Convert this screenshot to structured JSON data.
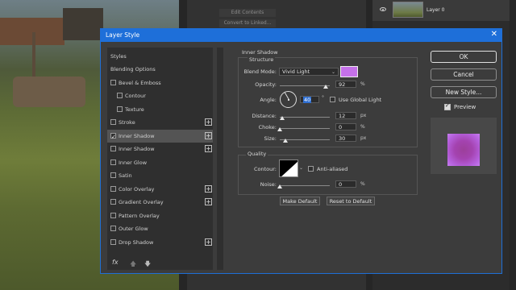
{
  "background": {
    "top_button_1": "Edit Contents",
    "top_button_2": "Convert to Linked...",
    "layer_name": "Layer 0"
  },
  "dialog": {
    "title": "Layer Style",
    "styles_header": "Styles",
    "items": [
      {
        "label": "Blending Options",
        "checkbox": false,
        "checked": false,
        "plus": false,
        "indent": false
      },
      {
        "label": "Bevel & Emboss",
        "checkbox": true,
        "checked": false,
        "plus": false,
        "indent": false
      },
      {
        "label": "Contour",
        "checkbox": true,
        "checked": false,
        "plus": false,
        "indent": true
      },
      {
        "label": "Texture",
        "checkbox": true,
        "checked": false,
        "plus": false,
        "indent": true
      },
      {
        "label": "Stroke",
        "checkbox": true,
        "checked": false,
        "plus": true,
        "indent": false
      },
      {
        "label": "Inner Shadow",
        "checkbox": true,
        "checked": true,
        "plus": true,
        "indent": false,
        "active": true
      },
      {
        "label": "Inner Shadow",
        "checkbox": true,
        "checked": false,
        "plus": true,
        "indent": false
      },
      {
        "label": "Inner Glow",
        "checkbox": true,
        "checked": false,
        "plus": false,
        "indent": false
      },
      {
        "label": "Satin",
        "checkbox": true,
        "checked": false,
        "plus": false,
        "indent": false
      },
      {
        "label": "Color Overlay",
        "checkbox": true,
        "checked": false,
        "plus": true,
        "indent": false
      },
      {
        "label": "Gradient Overlay",
        "checkbox": true,
        "checked": false,
        "plus": true,
        "indent": false
      },
      {
        "label": "Pattern Overlay",
        "checkbox": true,
        "checked": false,
        "plus": false,
        "indent": false
      },
      {
        "label": "Outer Glow",
        "checkbox": true,
        "checked": false,
        "plus": false,
        "indent": false
      },
      {
        "label": "Drop Shadow",
        "checkbox": true,
        "checked": false,
        "plus": true,
        "indent": false
      }
    ],
    "fx_label": "fx",
    "section_title": "Inner Shadow",
    "structure_label": "Structure",
    "blend_mode_label": "Blend Mode:",
    "blend_mode_value": "Vivid Light",
    "shadow_color": "#c571e9",
    "opacity_label": "Opacity:",
    "opacity_value": "92",
    "opacity_fraction": 0.92,
    "angle_label": "Angle:",
    "angle_value": "40",
    "use_global_light": "Use Global Light",
    "distance_label": "Distance:",
    "distance_value": "12",
    "distance_fraction": 0.05,
    "choke_label": "Choke:",
    "choke_value": "0",
    "choke_fraction": 0.0,
    "size_label": "Size:",
    "size_value": "30",
    "size_fraction": 0.12,
    "unit_px": "px",
    "unit_pct": "%",
    "quality_label": "Quality",
    "contour_label": "Contour:",
    "anti_aliased": "Anti-aliased",
    "noise_label": "Noise:",
    "noise_value": "0",
    "noise_fraction": 0.0,
    "make_default": "Make Default",
    "reset_default": "Reset to Default",
    "ok": "OK",
    "cancel": "Cancel",
    "new_style": "New Style...",
    "preview": "Preview",
    "accent_color": "#1e6fd9"
  }
}
